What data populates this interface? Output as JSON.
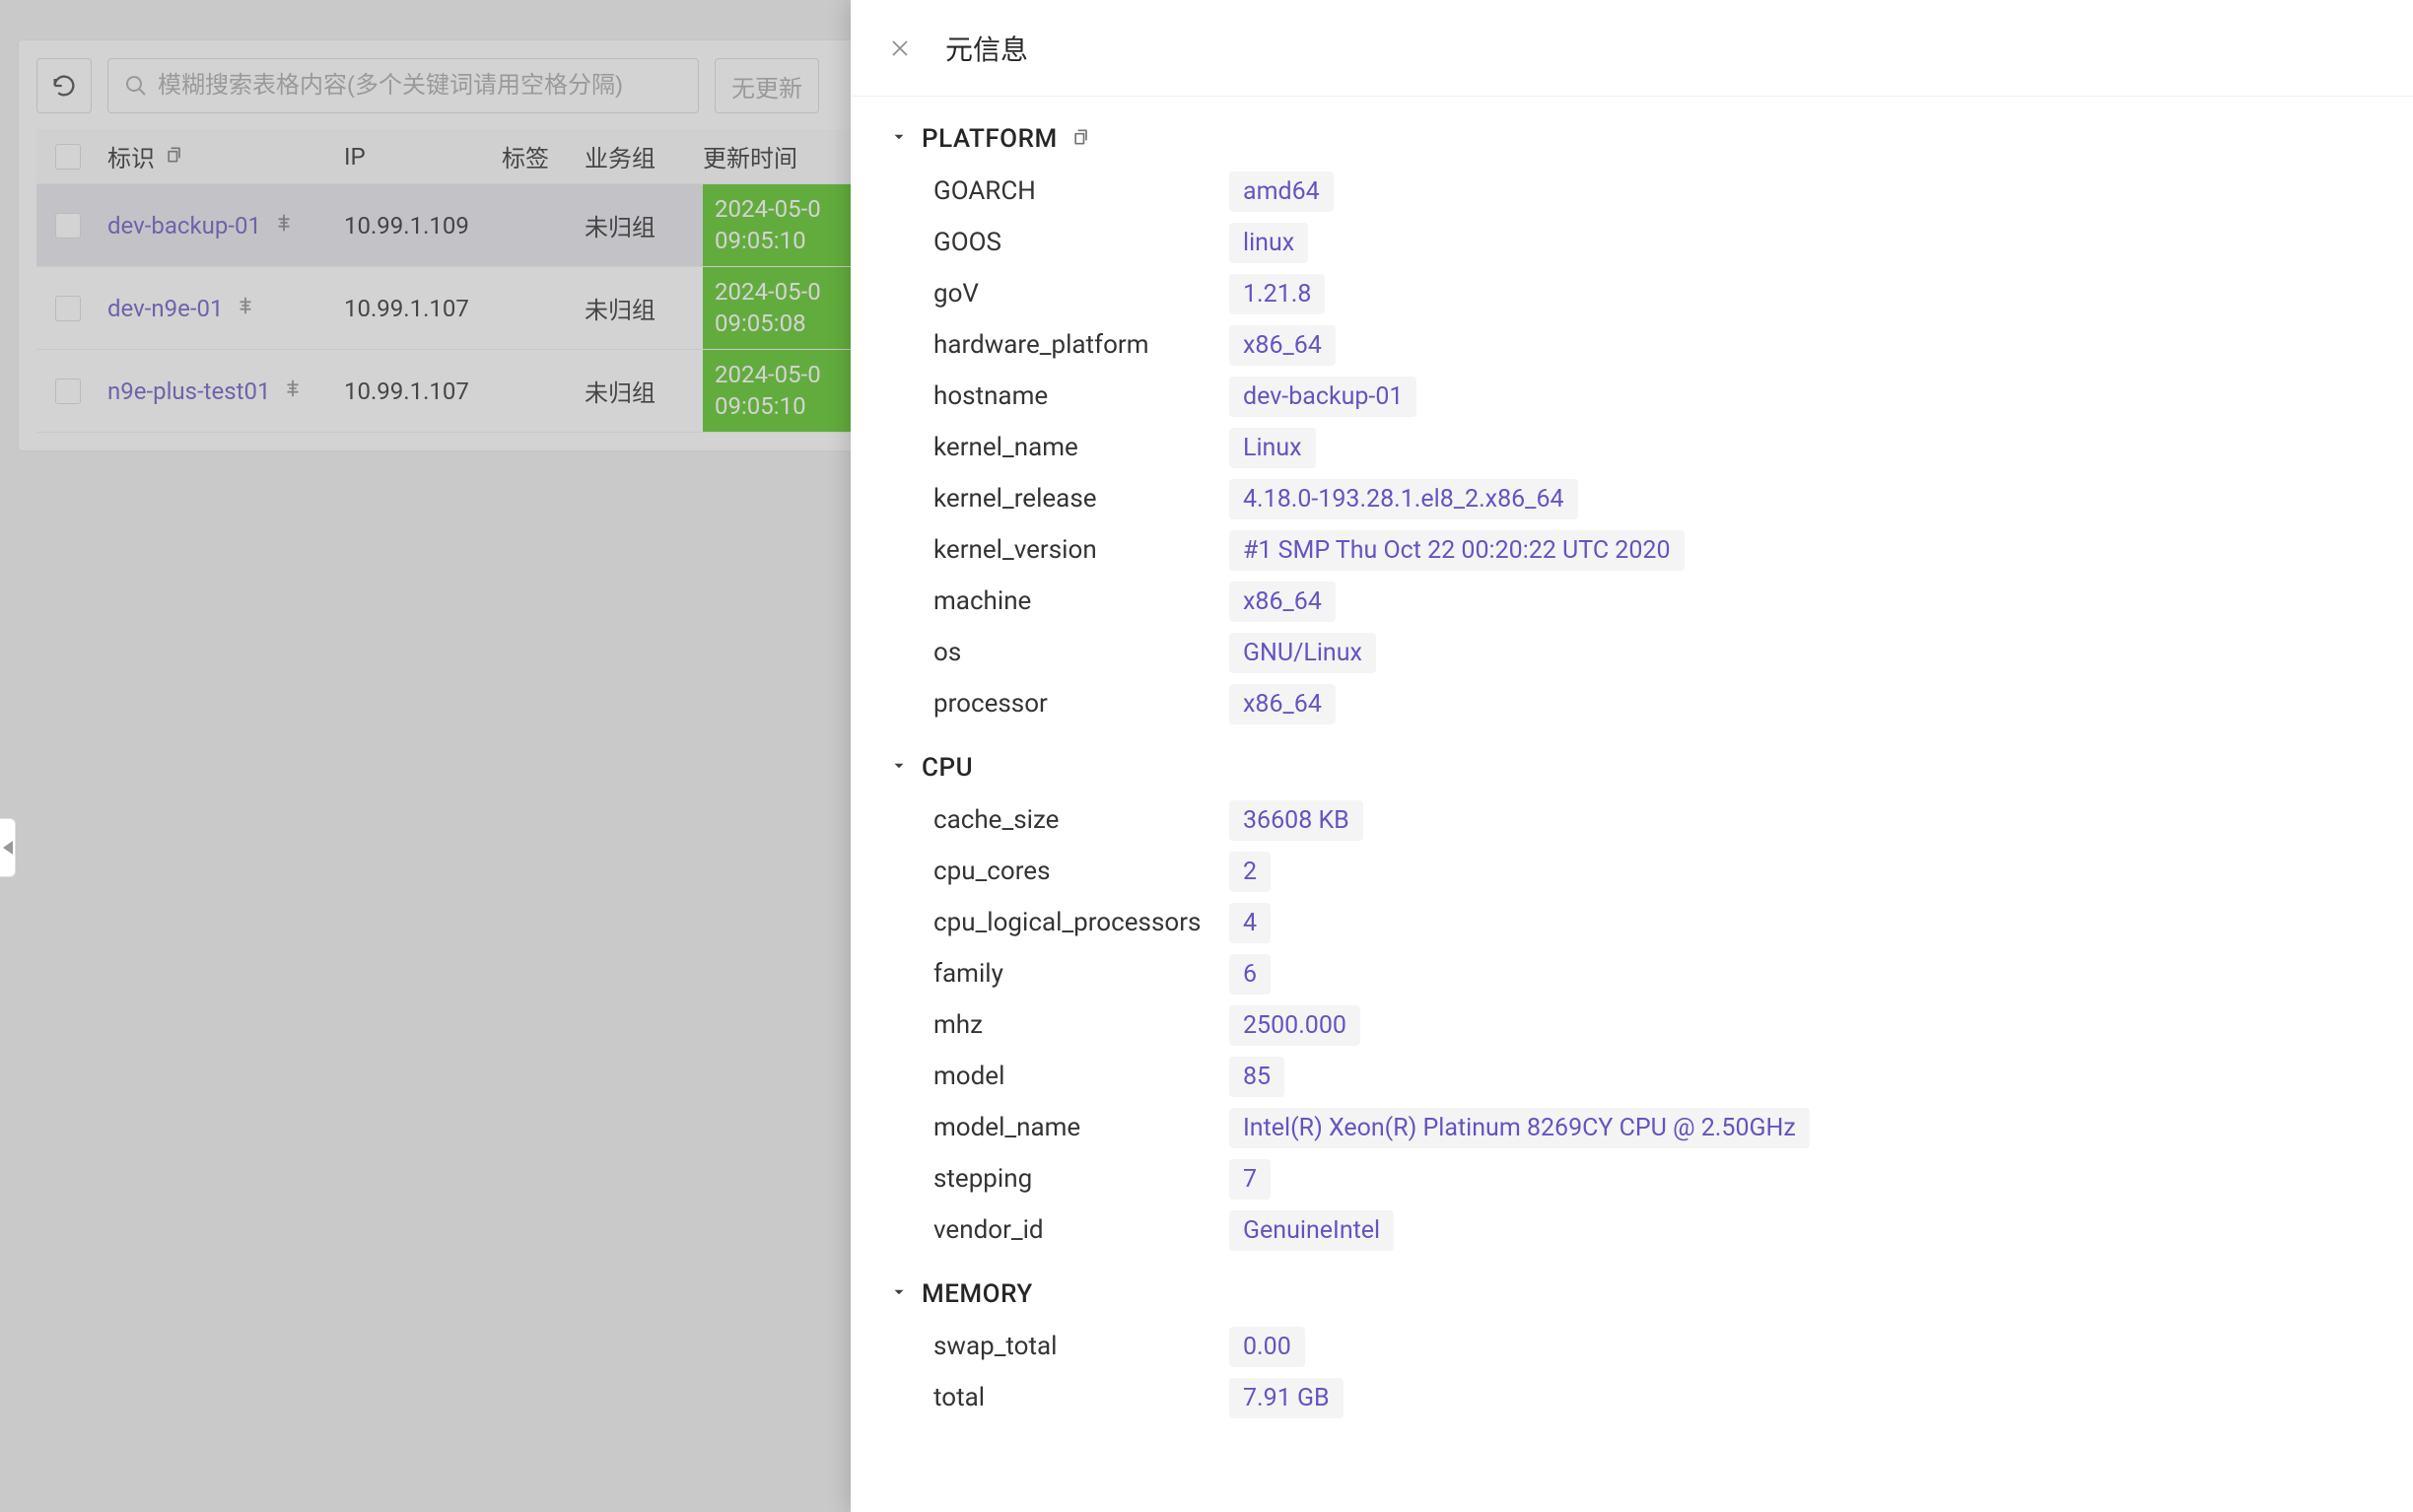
{
  "toolbar": {
    "search_placeholder": "模糊搜索表格内容(多个关键词请用空格分隔)",
    "filter_placeholder": "无更新"
  },
  "table": {
    "headers": {
      "id": "标识",
      "ip": "IP",
      "tag": "标签",
      "group": "业务组",
      "update_time": "更新时间"
    },
    "rows": [
      {
        "id": "dev-backup-01",
        "ip": "10.99.1.109",
        "group": "未归组",
        "time1": "2024-05-0",
        "time2": "09:05:10",
        "selected": true
      },
      {
        "id": "dev-n9e-01",
        "ip": "10.99.1.107",
        "group": "未归组",
        "time1": "2024-05-0",
        "time2": "09:05:08",
        "selected": false
      },
      {
        "id": "n9e-plus-test01",
        "ip": "10.99.1.107",
        "group": "未归组",
        "time1": "2024-05-0",
        "time2": "09:05:10",
        "selected": false
      }
    ]
  },
  "drawer": {
    "title": "元信息",
    "sections": [
      {
        "name": "PLATFORM",
        "copy_icon": true,
        "items": [
          {
            "key": "GOARCH",
            "value": "amd64"
          },
          {
            "key": "GOOS",
            "value": "linux"
          },
          {
            "key": "goV",
            "value": "1.21.8"
          },
          {
            "key": "hardware_platform",
            "value": "x86_64"
          },
          {
            "key": "hostname",
            "value": "dev-backup-01"
          },
          {
            "key": "kernel_name",
            "value": "Linux"
          },
          {
            "key": "kernel_release",
            "value": "4.18.0-193.28.1.el8_2.x86_64"
          },
          {
            "key": "kernel_version",
            "value": "#1 SMP Thu Oct 22 00:20:22 UTC 2020"
          },
          {
            "key": "machine",
            "value": "x86_64"
          },
          {
            "key": "os",
            "value": "GNU/Linux"
          },
          {
            "key": "processor",
            "value": "x86_64"
          }
        ]
      },
      {
        "name": "CPU",
        "copy_icon": false,
        "items": [
          {
            "key": "cache_size",
            "value": "36608 KB"
          },
          {
            "key": "cpu_cores",
            "value": "2"
          },
          {
            "key": "cpu_logical_processors",
            "value": "4"
          },
          {
            "key": "family",
            "value": "6"
          },
          {
            "key": "mhz",
            "value": "2500.000"
          },
          {
            "key": "model",
            "value": "85"
          },
          {
            "key": "model_name",
            "value": "Intel(R) Xeon(R) Platinum 8269CY CPU @ 2.50GHz"
          },
          {
            "key": "stepping",
            "value": "7"
          },
          {
            "key": "vendor_id",
            "value": "GenuineIntel"
          }
        ]
      },
      {
        "name": "MEMORY",
        "copy_icon": false,
        "items": [
          {
            "key": "swap_total",
            "value": "0.00"
          },
          {
            "key": "total",
            "value": "7.91 GB"
          }
        ]
      }
    ]
  }
}
